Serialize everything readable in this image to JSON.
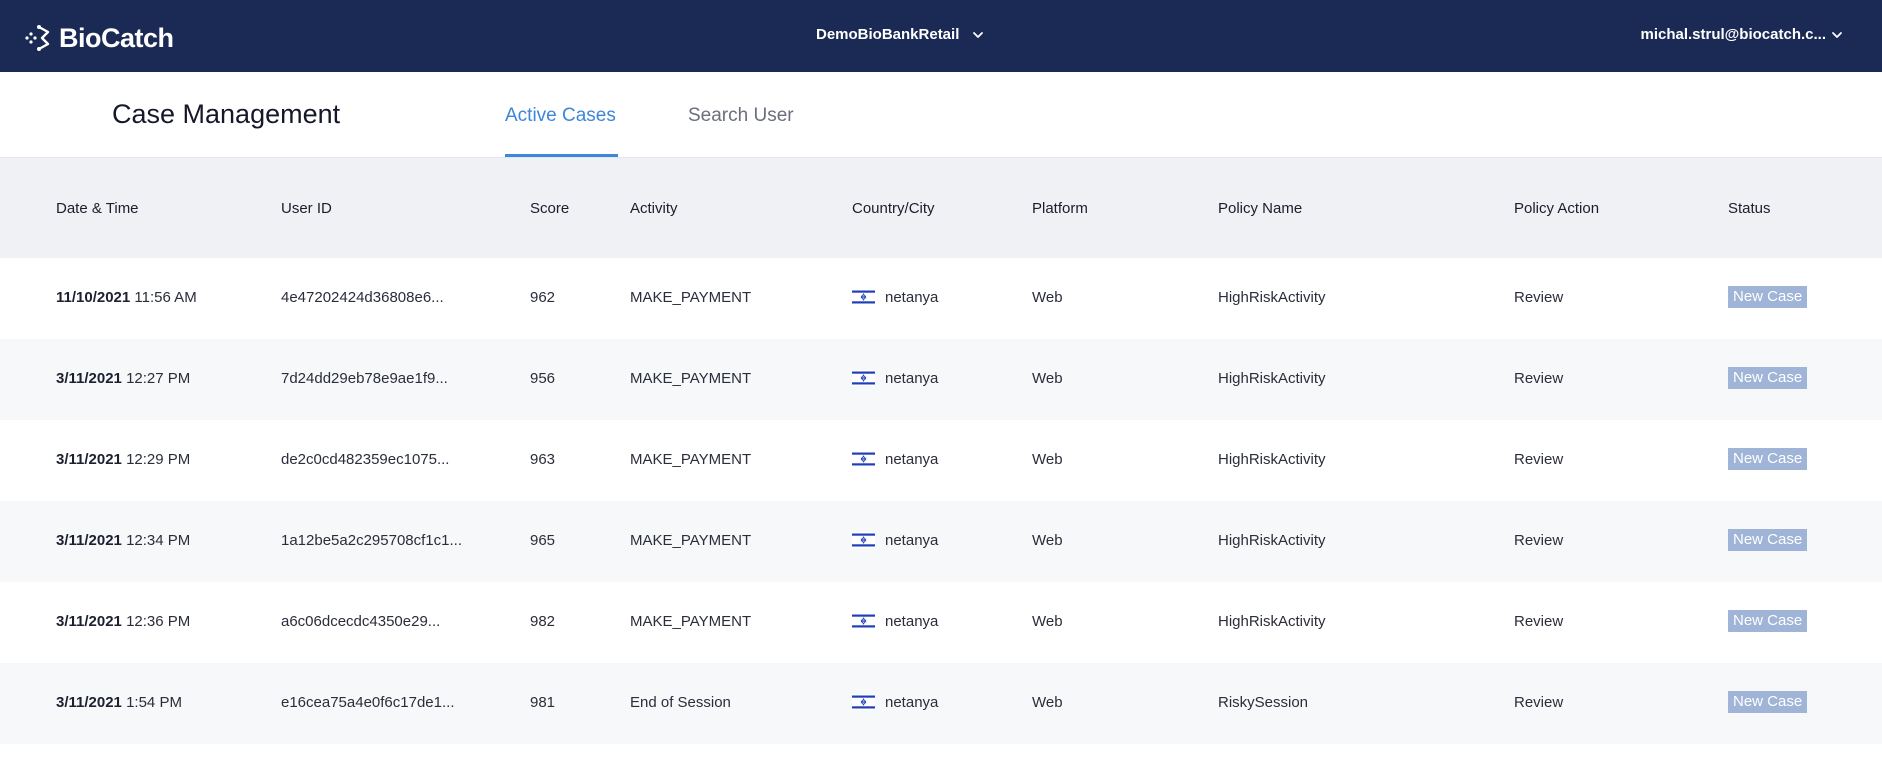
{
  "header": {
    "brand": "BioCatch",
    "tenant": "DemoBioBankRetail",
    "user": "michal.strul@biocatch.c..."
  },
  "page": {
    "title": "Case Management",
    "tabs": [
      {
        "label": "Active Cases",
        "active": true
      },
      {
        "label": "Search User",
        "active": false
      }
    ]
  },
  "table": {
    "columns": [
      "Date & Time",
      "User ID",
      "Score",
      "Activity",
      "Country/City",
      "Platform",
      "Policy Name",
      "Policy Action",
      "Status"
    ],
    "rows": [
      {
        "date": "11/10/2021",
        "time": "11:56 AM",
        "user_id": "4e47202424d36808e6...",
        "score": "962",
        "activity": "MAKE_PAYMENT",
        "city": "netanya",
        "platform": "Web",
        "policy_name": "HighRiskActivity",
        "policy_action": "Review",
        "status": "New Case"
      },
      {
        "date": "3/11/2021",
        "time": "12:27 PM",
        "user_id": "7d24dd29eb78e9ae1f9...",
        "score": "956",
        "activity": "MAKE_PAYMENT",
        "city": "netanya",
        "platform": "Web",
        "policy_name": "HighRiskActivity",
        "policy_action": "Review",
        "status": "New Case"
      },
      {
        "date": "3/11/2021",
        "time": "12:29 PM",
        "user_id": "de2c0cd482359ec1075...",
        "score": "963",
        "activity": "MAKE_PAYMENT",
        "city": "netanya",
        "platform": "Web",
        "policy_name": "HighRiskActivity",
        "policy_action": "Review",
        "status": "New Case"
      },
      {
        "date": "3/11/2021",
        "time": "12:34 PM",
        "user_id": "1a12be5a2c295708cf1c1...",
        "score": "965",
        "activity": "MAKE_PAYMENT",
        "city": "netanya",
        "platform": "Web",
        "policy_name": "HighRiskActivity",
        "policy_action": "Review",
        "status": "New Case"
      },
      {
        "date": "3/11/2021",
        "time": "12:36 PM",
        "user_id": "a6c06dcecdc4350e29...",
        "score": "982",
        "activity": "MAKE_PAYMENT",
        "city": "netanya",
        "platform": "Web",
        "policy_name": "HighRiskActivity",
        "policy_action": "Review",
        "status": "New Case"
      },
      {
        "date": "3/11/2021",
        "time": "1:54 PM",
        "user_id": "e16cea75a4e0f6c17de1...",
        "score": "981",
        "activity": "End of Session",
        "city": "netanya",
        "platform": "Web",
        "policy_name": "RiskySession",
        "policy_action": "Review",
        "status": "New Case"
      }
    ]
  },
  "icons": {
    "logo": "biocatch-logo-icon",
    "chevron": "chevron-down-icon",
    "flag": "israel-flag-icon"
  },
  "colors": {
    "topbar": "#1a2a55",
    "accent": "#3d86d8",
    "badge": "#9fb4d6",
    "header_row": "#eff1f5"
  }
}
